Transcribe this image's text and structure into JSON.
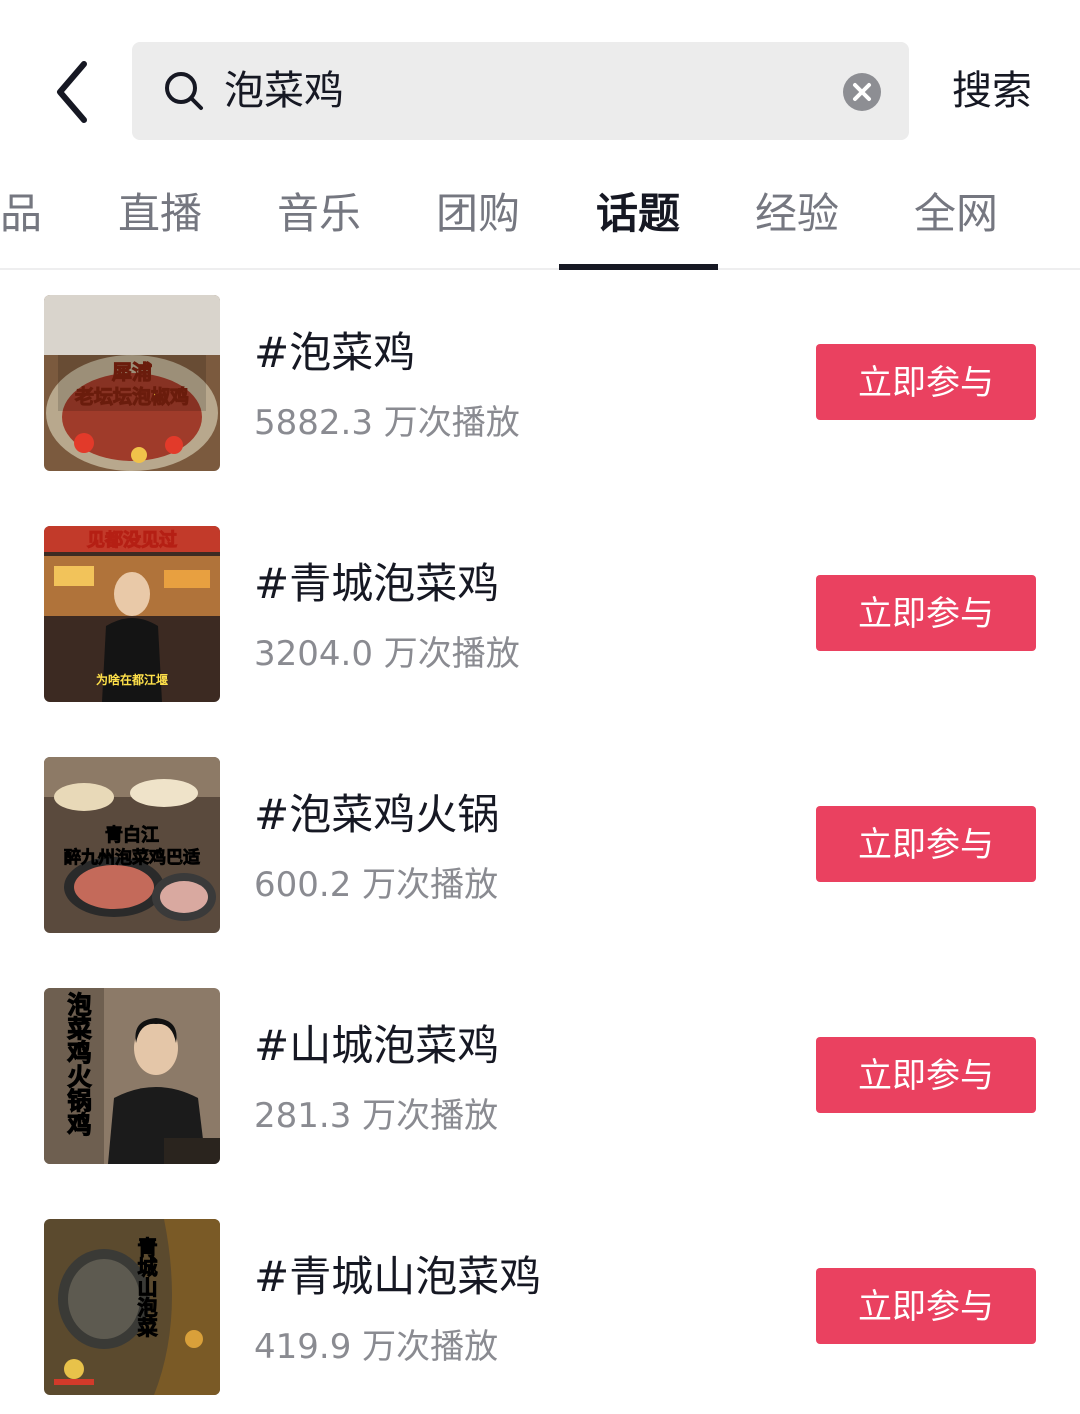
{
  "search": {
    "query": "泡菜鸡",
    "submit_label": "搜索"
  },
  "tabs": [
    {
      "label": "品"
    },
    {
      "label": "直播"
    },
    {
      "label": "音乐"
    },
    {
      "label": "团购"
    },
    {
      "label": "话题",
      "active": true
    },
    {
      "label": "经验"
    },
    {
      "label": "全网"
    }
  ],
  "topics": [
    {
      "title": "#泡菜鸡",
      "plays": "5882.3 万次播放",
      "button": "立即参与",
      "thumb_caption": [
        "犀浦",
        "老坛坛泡椒鸡"
      ]
    },
    {
      "title": "#青城泡菜鸡",
      "plays": "3204.0 万次播放",
      "button": "立即参与",
      "thumb_caption": [
        "见都没见过",
        "为啥在都江堰"
      ]
    },
    {
      "title": "#泡菜鸡火锅",
      "plays": "600.2 万次播放",
      "button": "立即参与",
      "thumb_caption": [
        "青白江",
        "醉九州泡菜鸡巴适"
      ]
    },
    {
      "title": "#山城泡菜鸡",
      "plays": "281.3 万次播放",
      "button": "立即参与",
      "thumb_caption": [
        "泡菜鸡火锅鸡"
      ]
    },
    {
      "title": "#青城山泡菜鸡",
      "plays": "419.9 万次播放",
      "button": "立即参与",
      "thumb_caption": [
        "青城山泡菜"
      ]
    }
  ],
  "colors": {
    "accent": "#ea4160",
    "text_primary": "#161823",
    "text_secondary": "#8a8b91",
    "search_bg": "#ececec"
  }
}
